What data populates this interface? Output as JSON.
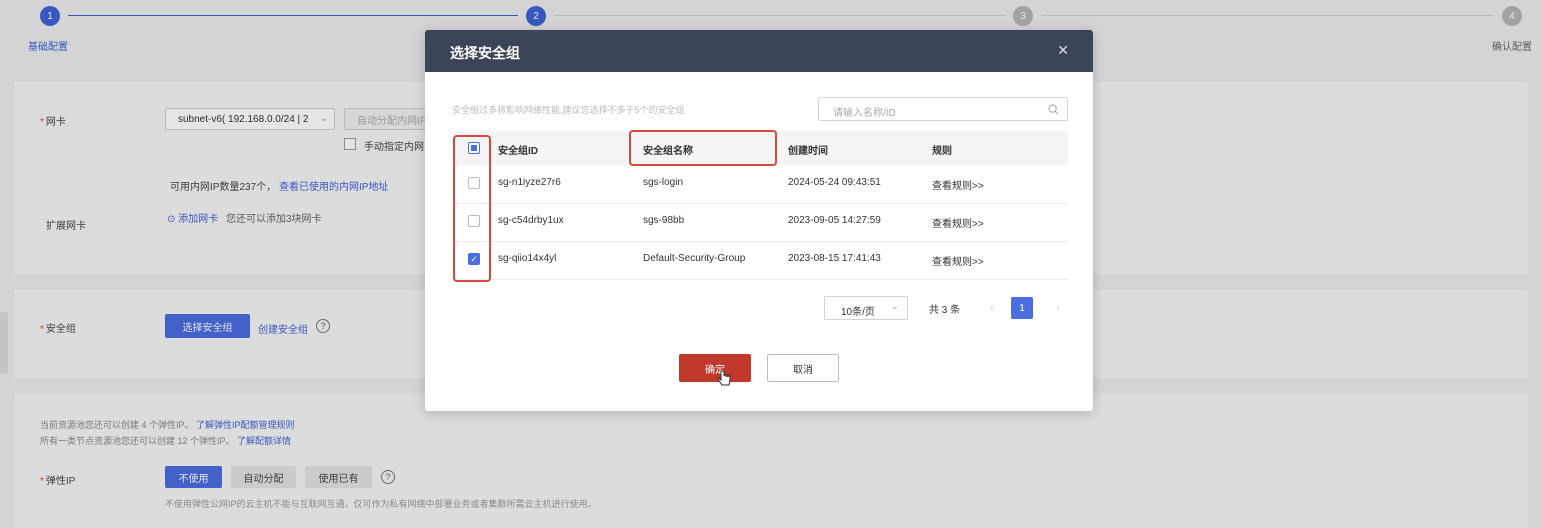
{
  "stepper": {
    "steps": [
      {
        "num": "1",
        "label": "基础配置"
      },
      {
        "num": "2",
        "label": ""
      },
      {
        "num": "3",
        "label": ""
      },
      {
        "num": "4",
        "label": "确认配置"
      }
    ]
  },
  "nic": {
    "label": "网卡",
    "subnet_value": "subnet-v6( 192.168.0.0/24 | 2",
    "auto_ip": "自动分配内网IP",
    "manual_ip": "手动指定内网",
    "available": "可用内网IP数量237个，",
    "view_used": "查看已使用的内网IP地址",
    "ext_label": "扩展网卡",
    "add_nic": "添加网卡",
    "add_hint": "您还可以添加3块网卡"
  },
  "security_group": {
    "label": "安全组",
    "select_btn": "选择安全组",
    "create_link": "创建安全组"
  },
  "eip": {
    "quota_text1": "当前资源池您还可以创建 4 个弹性IP。",
    "quota_link1": "了解弹性IP配额管理规则",
    "quota_text2": "所有一类节点资源池您还可以创建 12 个弹性IP。",
    "quota_link2": "了解配额详情",
    "label": "弹性IP",
    "opt_none": "不使用",
    "opt_auto": "自动分配",
    "opt_existing": "使用已有",
    "note": "不使用弹性公网IP的云主机不能与互联网互通，仅可作为私有网络中部署业务或者集群所需云主机进行使用。"
  },
  "modal": {
    "title": "选择安全组",
    "hint": "安全组过多将影响网络性能,建议您选择不多于5个的安全组",
    "search_placeholder": "请输入名称/ID",
    "columns": {
      "id": "安全组ID",
      "name": "安全组名称",
      "created": "创建时间",
      "rules": "规则"
    },
    "rows": [
      {
        "id": "sg-n1iyze27r6",
        "name": "sgs-login",
        "created": "2024-05-24 09:43:51",
        "rules": "查看规则>>",
        "checked": false
      },
      {
        "id": "sg-c54drby1ux",
        "name": "sgs-98bb",
        "created": "2023-09-05 14:27:59",
        "rules": "查看规则>>",
        "checked": false
      },
      {
        "id": "sg-qiio14x4yl",
        "name": "Default-Security-Group",
        "created": "2023-08-15 17:41:43",
        "rules": "查看规则>>",
        "checked": true
      }
    ],
    "pagination": {
      "page_size": "10条/页",
      "total": "共 3 条",
      "current_page": "1"
    },
    "ok": "确定",
    "cancel": "取消"
  },
  "colors": {
    "primary": "#4a6de0",
    "modal_header": "#3b4459",
    "confirm": "#c0392b",
    "highlight": "#d94a3d"
  }
}
